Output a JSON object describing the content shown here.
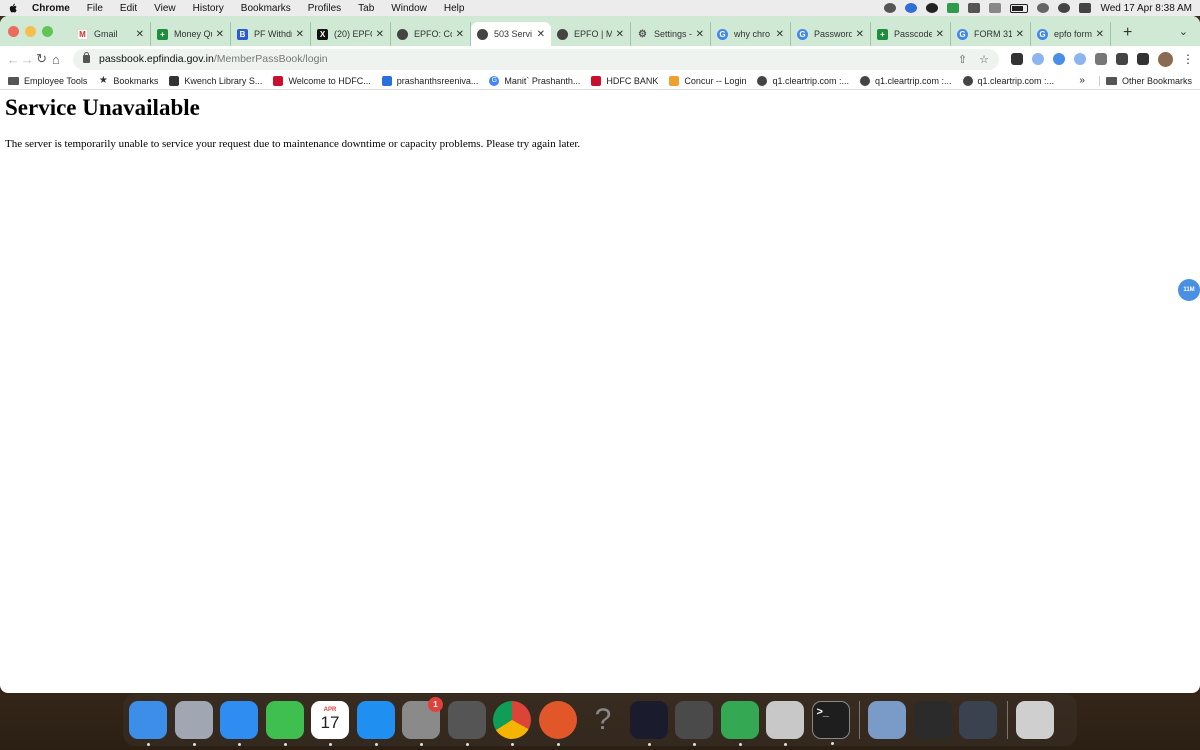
{
  "menubar": {
    "items": [
      "Chrome",
      "File",
      "Edit",
      "View",
      "History",
      "Bookmarks",
      "Profiles",
      "Tab",
      "Window",
      "Help"
    ],
    "clock": "Wed 17 Apr  8:38 AM"
  },
  "tabs": [
    {
      "label": "Gmail",
      "favicon": "gmail-icon",
      "color": "#ffffff"
    },
    {
      "label": "Money Qu",
      "favicon": "plus-icon",
      "color": "#1e8e3e"
    },
    {
      "label": "PF Withdr",
      "favicon": "b-icon",
      "color": "#2a5bd7"
    },
    {
      "label": "(20) EPFO",
      "favicon": "x-icon",
      "color": "#111111"
    },
    {
      "label": "EPFO: Co",
      "favicon": "globe-icon",
      "color": "#444444"
    },
    {
      "label": "503 Servi",
      "favicon": "globe-icon",
      "color": "#444444",
      "active": true
    },
    {
      "label": "EPFO | M",
      "favicon": "globe-icon",
      "color": "#444444"
    },
    {
      "label": "Settings -",
      "favicon": "gear-icon",
      "color": "#555555"
    },
    {
      "label": "why chro",
      "favicon": "google-icon",
      "color": "#4285f4"
    },
    {
      "label": "Password",
      "favicon": "google-icon",
      "color": "#4285f4"
    },
    {
      "label": "Passcode",
      "favicon": "plus-icon",
      "color": "#1e8e3e"
    },
    {
      "label": "FORM 31",
      "favicon": "google-icon",
      "color": "#4285f4"
    },
    {
      "label": "epfo form",
      "favicon": "google-icon",
      "color": "#4285f4"
    }
  ],
  "omnibox": {
    "host": "passbook.epfindia.gov.in",
    "path": "/MemberPassBook/login"
  },
  "bookmarks": [
    {
      "label": "Employee Tools",
      "icon": "folder-icon",
      "color": "#555555"
    },
    {
      "label": "Bookmarks",
      "icon": "star-icon",
      "color": "#333333"
    },
    {
      "label": "Kwench Library S...",
      "icon": "book-icon",
      "color": "#333333"
    },
    {
      "label": "Welcome to HDFC...",
      "icon": "hdfc-icon",
      "color": "#c8102e"
    },
    {
      "label": "prashanthsreeniva...",
      "icon": "drive-icon",
      "color": "#2a6fdb"
    },
    {
      "label": "Manit` Prashanth...",
      "icon": "google-icon",
      "color": "#4285f4"
    },
    {
      "label": "HDFC BANK",
      "icon": "hdfc-icon",
      "color": "#c8102e"
    },
    {
      "label": "Concur -- Login",
      "icon": "concur-icon",
      "color": "#f0a030"
    },
    {
      "label": "q1.cleartrip.com :...",
      "icon": "globe-icon",
      "color": "#444444"
    },
    {
      "label": "q1.cleartrip.com :...",
      "icon": "globe-icon",
      "color": "#444444"
    },
    {
      "label": "q1.cleartrip.com :...",
      "icon": "globe-icon",
      "color": "#444444"
    }
  ],
  "other_bookmarks": "Other Bookmarks",
  "page": {
    "heading": "Service Unavailable",
    "message": "The server is temporarily unable to service your request due to maintenance downtime or capacity problems. Please try again later."
  },
  "floating_badge": "11M",
  "calendar": {
    "month": "APR",
    "day": "17"
  },
  "settings_badge": "1",
  "dock": [
    {
      "name": "finder-icon",
      "color": "#3d8ee8"
    },
    {
      "name": "launchpad-icon",
      "color": "#a0a7b2"
    },
    {
      "name": "safari-icon",
      "color": "#2f8cf0"
    },
    {
      "name": "facetime-icon",
      "color": "#3fbf4f"
    },
    {
      "name": "calendar-icon",
      "color": "#ffffff"
    },
    {
      "name": "app-store-icon",
      "color": "#1f8ff2"
    },
    {
      "name": "system-settings-icon",
      "color": "#8a8a8a"
    },
    {
      "name": "calculator-icon",
      "color": "#555555"
    },
    {
      "name": "chrome-icon",
      "color": "#e8e8e8"
    },
    {
      "name": "firefox-icon",
      "color": "#e2572a"
    },
    {
      "name": "help-icon",
      "color": "#6b6b6b"
    },
    {
      "name": "intellij-icon",
      "color": "#1b1b2e"
    },
    {
      "name": "sublime-icon",
      "color": "#4a4a4a"
    },
    {
      "name": "google-chat-icon",
      "color": "#34a853"
    },
    {
      "name": "database-icon",
      "color": "#c8c8c8"
    },
    {
      "name": "terminal-icon",
      "color": "#1e1e1e"
    },
    {
      "name": "preview-icon",
      "color": "#7a9ac8"
    },
    {
      "name": "window-thumbnail-icon",
      "color": "#2b2b2b"
    },
    {
      "name": "window-thumbnail-icon",
      "color": "#3a4250"
    },
    {
      "name": "trash-icon",
      "color": "#cfcfcf"
    }
  ]
}
